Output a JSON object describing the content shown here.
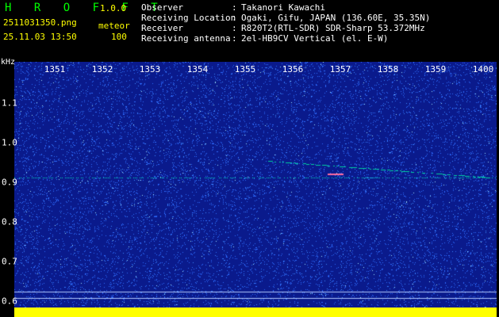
{
  "header": {
    "title": "H R O F F T",
    "version": "1.0.0",
    "filename": "2511031350.png",
    "datetime": "25.11.03 13:50",
    "mode_label": "meteor",
    "mode_value": "100"
  },
  "info": [
    {
      "label": "Observer",
      "value": "Takanori Kawachi"
    },
    {
      "label": "Receiving Location",
      "value": "Ogaki, Gifu, JAPAN (136.60E, 35.35N)"
    },
    {
      "label": "Receiver",
      "value": "R820T2(RTL-SDR) SDR-Sharp 53.372MHz"
    },
    {
      "label": "Receiving antenna",
      "value": "2el-HB9CV Vertical (el. E-W)"
    }
  ],
  "x_axis": {
    "ticks": [
      "1351",
      "1352",
      "1353",
      "1354",
      "1355",
      "1356",
      "1357",
      "1358",
      "1359",
      "1400"
    ]
  },
  "y_axis": {
    "unit": "kHz",
    "ticks": [
      "1.1",
      "1.0",
      "0.9",
      "0.8",
      "0.7",
      "0.6"
    ]
  },
  "colors": {
    "background": "#0a1a8c",
    "noise": "#2e6cff",
    "trace": "#00e0c0",
    "strip": "#ffff00"
  }
}
